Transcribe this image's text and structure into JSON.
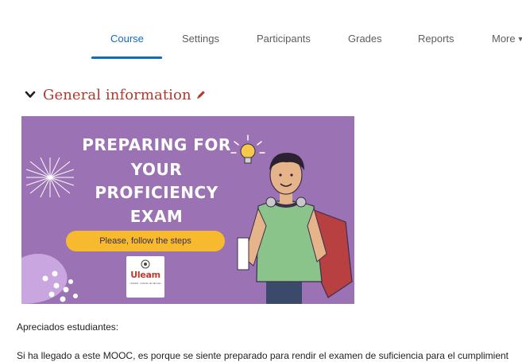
{
  "tabs": [
    {
      "label": "Course",
      "active": true
    },
    {
      "label": "Settings",
      "active": false
    },
    {
      "label": "Participants",
      "active": false
    },
    {
      "label": "Grades",
      "active": false
    },
    {
      "label": "Reports",
      "active": false
    },
    {
      "label": "More",
      "active": false
    }
  ],
  "section": {
    "title": "General information",
    "collapse_icon": "chevron-down-icon",
    "edit_icon": "pencil-icon"
  },
  "banner": {
    "lines": [
      "PREPARING FOR",
      "YOUR",
      "PROFICIENCY",
      "EXAM"
    ],
    "pill_text": "Please, follow the steps",
    "logo_text": "Uleam",
    "logo_sub": "ULEAM · Instituto de Idiomas"
  },
  "content": {
    "greeting": "Apreciados estudiantes:",
    "paragraph": "Si ha llegado a este MOOC, es porque se siente preparado para rendir el examen de suficiencia para el cumplimient"
  },
  "colors": {
    "accent": "#0f6cbf",
    "section_title": "#b03a2e",
    "banner_bg": "#9b72b3",
    "pill": "#f7b92e"
  }
}
